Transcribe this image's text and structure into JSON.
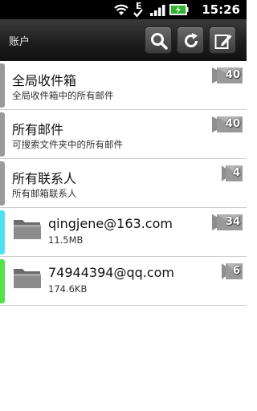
{
  "status_bar": {
    "time": "15:26",
    "network_type": "E",
    "icons": [
      "wifi-icon",
      "signal-icon",
      "battery-icon"
    ]
  },
  "header": {
    "title": "账户",
    "buttons": [
      "search-icon",
      "refresh-icon",
      "compose-icon"
    ]
  },
  "items": [
    {
      "title": "全局收件箱",
      "subtitle": "全局收件箱中的所有邮件",
      "count": "40",
      "bar_color": "#9a9a9a"
    },
    {
      "title": "所有邮件",
      "subtitle": "可搜索文件夹中的所有邮件",
      "count": "40",
      "bar_color": "#9a9a9a"
    },
    {
      "title": "所有联系人",
      "subtitle": "所有邮箱联系人",
      "count": "4",
      "bar_color": "#9a9a9a"
    }
  ],
  "accounts": [
    {
      "email": "qingjene@163.com",
      "size": "11.5MB",
      "count": "34",
      "bar_color": "#4ee0f2"
    },
    {
      "email": "74944394@qq.com",
      "size": "174.6KB",
      "count": "6",
      "bar_color": "#53e24a"
    }
  ]
}
